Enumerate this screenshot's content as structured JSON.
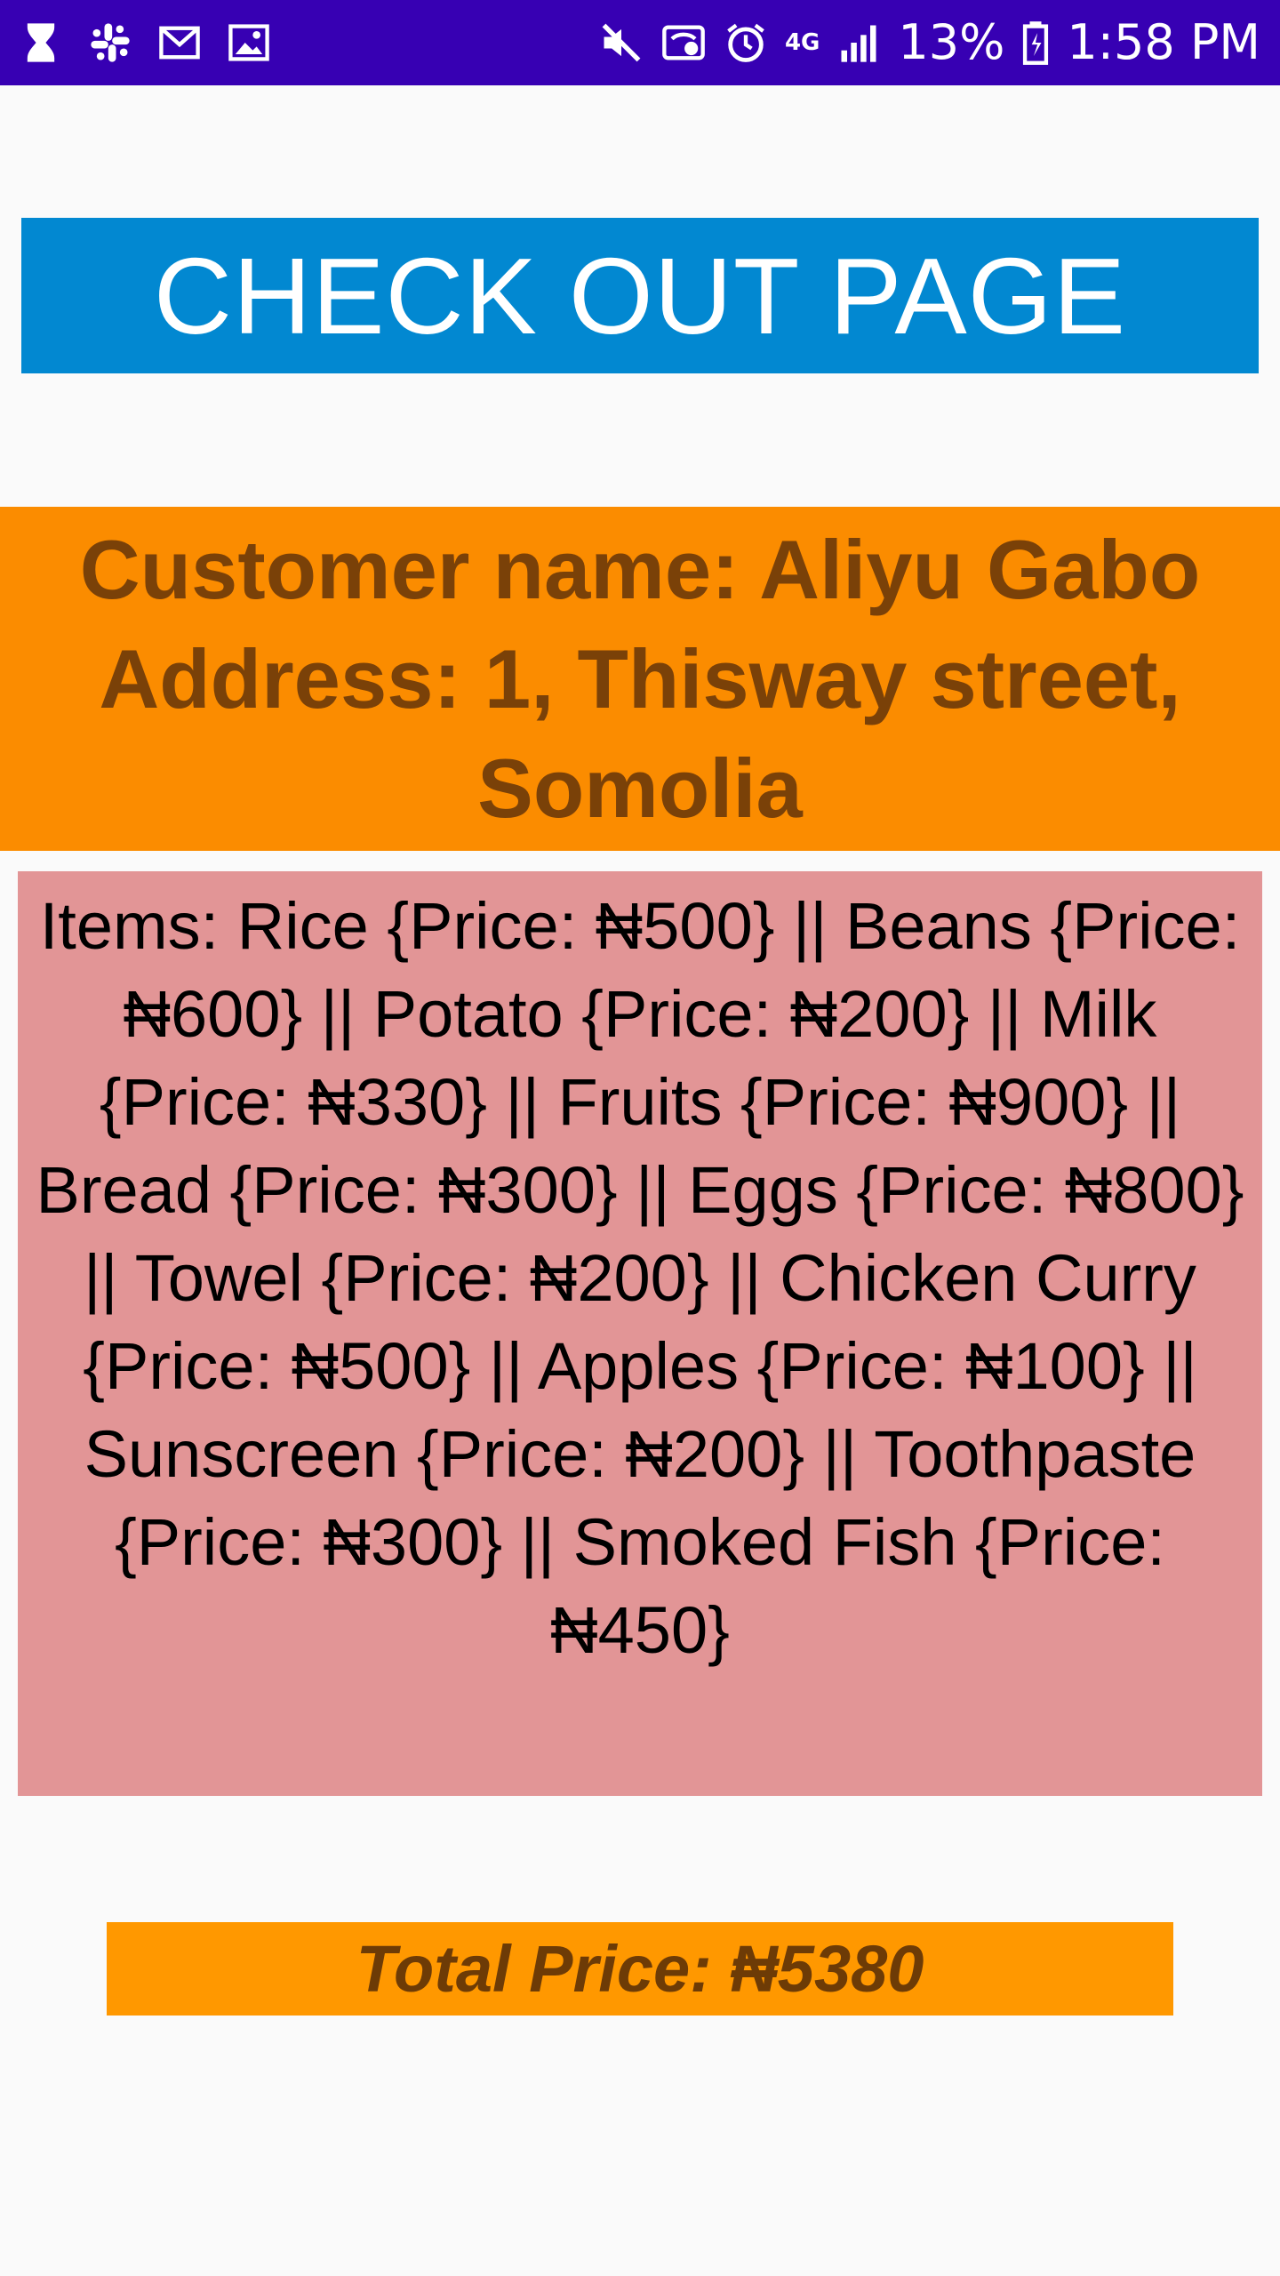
{
  "status_bar": {
    "battery": "13%",
    "time": "1:58 PM",
    "network": "4G",
    "left_icons": [
      "hourglass-icon",
      "slack-icon",
      "mail-icon",
      "image-icon"
    ],
    "right_icons": [
      "mute-icon",
      "wifi-calling-icon",
      "alarm-icon",
      "network-4g-icon",
      "signal-icon",
      "battery-icon"
    ],
    "color": "#3700b3"
  },
  "checkout": {
    "title": "CHECK OUT PAGE",
    "color": "#0288d1"
  },
  "customer": {
    "name_line": "Customer name: Aliyu Gabo",
    "address_line": "Address: 1, Thisway street, Somolia",
    "color": "#fb8c00"
  },
  "items": {
    "text": "Items: Rice {Price: ₦500}  || Beans {Price: ₦600}  || Potato {Price: ₦200}  || Milk {Price: ₦330}  || Fruits {Price: ₦900} || Bread {Price: ₦300}  || Eggs {Price: ₦800}  || Towel {Price: ₦200}  || Chicken Curry {Price: ₦500}  || Apples {Price: ₦100}  || Sunscreen {Price: ₦200} || Toothpaste {Price: ₦300} || Smoked Fish {Price: ₦450}",
    "color": "#e29596"
  },
  "total": {
    "text": "Total Price: ₦5380",
    "color": "#ff9800"
  }
}
